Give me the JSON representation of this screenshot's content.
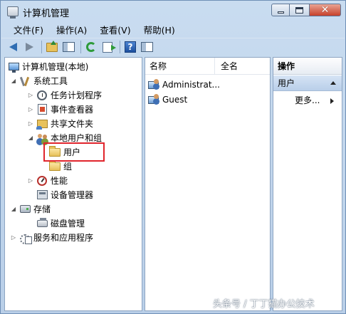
{
  "window": {
    "title": "计算机管理"
  },
  "menu": [
    "文件(F)",
    "操作(A)",
    "查看(V)",
    "帮助(H)"
  ],
  "toolbar": {
    "help_glyph": "?"
  },
  "window_buttons": {
    "close_glyph": "✕"
  },
  "tree": {
    "root": "计算机管理(本地)",
    "system_tools": "系统工具",
    "task_scheduler": "任务计划程序",
    "event_viewer": "事件查看器",
    "shared_folders": "共享文件夹",
    "local_users_groups": "本地用户和组",
    "users": "用户",
    "groups": "组",
    "performance": "性能",
    "device_manager": "设备管理器",
    "storage": "存储",
    "disk_management": "磁盘管理",
    "services_apps": "服务和应用程序"
  },
  "list": {
    "columns": [
      "名称",
      "全名"
    ],
    "rows": [
      {
        "name": "Administrat..."
      },
      {
        "name": "Guest"
      }
    ]
  },
  "actions": {
    "header": "操作",
    "section": "用户",
    "more": "更多..."
  },
  "watermark": "头条号 / 丁丁猫办公技术",
  "colors": {
    "highlight_box": "#e0252c",
    "window_frame": "#b9cfe8"
  }
}
